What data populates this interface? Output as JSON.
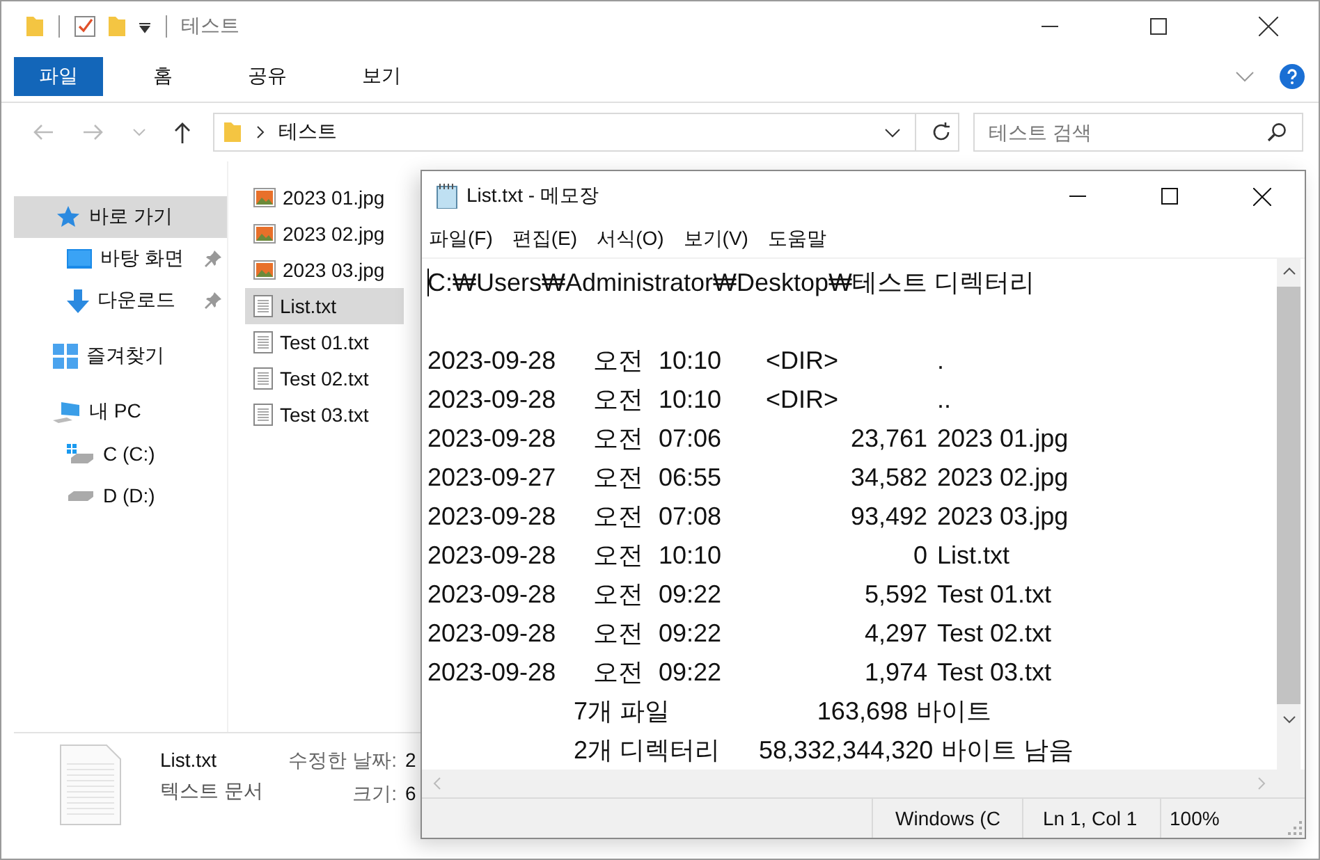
{
  "explorer": {
    "title": "테스트",
    "ribbon_tabs": [
      {
        "label": "파일",
        "selected": true
      },
      {
        "label": "홈",
        "selected": false
      },
      {
        "label": "공유",
        "selected": false
      },
      {
        "label": "보기",
        "selected": false
      }
    ],
    "address": {
      "path": "테스트"
    },
    "search": {
      "placeholder": "테스트 검색"
    },
    "nav": [
      {
        "label": "바로 가기",
        "kind": "star",
        "selected": true,
        "children": [
          {
            "label": "바탕 화면",
            "kind": "desktop",
            "pinned": true,
            "selected": false
          },
          {
            "label": "다운로드",
            "kind": "download",
            "pinned": true,
            "selected": false
          }
        ]
      },
      {
        "label": "즐겨찾기",
        "kind": "tiles",
        "selected": false
      },
      {
        "label": "내 PC",
        "kind": "pc",
        "selected": false,
        "children": [
          {
            "label": "C (C:)",
            "kind": "system-drive",
            "selected": false
          },
          {
            "label": "D (D:)",
            "kind": "drive",
            "selected": false
          }
        ]
      }
    ],
    "files": [
      {
        "name": "2023 01.jpg",
        "kind": "image",
        "selected": false
      },
      {
        "name": "2023 02.jpg",
        "kind": "image",
        "selected": false
      },
      {
        "name": "2023 03.jpg",
        "kind": "image",
        "selected": false
      },
      {
        "name": "List.txt",
        "kind": "text",
        "selected": true
      },
      {
        "name": "Test 01.txt",
        "kind": "text",
        "selected": false
      },
      {
        "name": "Test 02.txt",
        "kind": "text",
        "selected": false
      },
      {
        "name": "Test 03.txt",
        "kind": "text",
        "selected": false
      }
    ],
    "details": {
      "name": "List.txt",
      "type": "텍스트 문서",
      "fields": [
        {
          "label": "수정한 날짜:",
          "value": "2"
        },
        {
          "label": "크기:",
          "value": "6"
        }
      ]
    }
  },
  "notepad": {
    "title": "List.txt - 메모장",
    "menu": [
      "파일(F)",
      "편집(E)",
      "서식(O)",
      "보기(V)",
      "도움말"
    ],
    "path_line": "C:₩Users₩Administrator₩Desktop₩테스트 디렉터리",
    "entries": [
      {
        "date": "2023-09-28",
        "period": "오전",
        "time": "10:10",
        "dir": "<DIR>",
        "name": "."
      },
      {
        "date": "2023-09-28",
        "period": "오전",
        "time": "10:10",
        "dir": "<DIR>",
        "name": ".."
      },
      {
        "date": "2023-09-28",
        "period": "오전",
        "time": "07:06",
        "size": "23,761",
        "name": "2023 01.jpg"
      },
      {
        "date": "2023-09-27",
        "period": "오전",
        "time": "06:55",
        "size": "34,582",
        "name": "2023 02.jpg"
      },
      {
        "date": "2023-09-28",
        "period": "오전",
        "time": "07:08",
        "size": "93,492",
        "name": "2023 03.jpg"
      },
      {
        "date": "2023-09-28",
        "period": "오전",
        "time": "10:10",
        "size": "0",
        "name": "List.txt"
      },
      {
        "date": "2023-09-28",
        "period": "오전",
        "time": "09:22",
        "size": "5,592",
        "name": "Test 01.txt"
      },
      {
        "date": "2023-09-28",
        "period": "오전",
        "time": "09:22",
        "size": "4,297",
        "name": "Test 02.txt"
      },
      {
        "date": "2023-09-28",
        "period": "오전",
        "time": "09:22",
        "size": "1,974",
        "name": "Test 03.txt"
      }
    ],
    "summary": [
      {
        "label": "7개 파일",
        "size": "163,698",
        "unit": "바이트"
      },
      {
        "label": "2개 디렉터리",
        "size": "58,332,344,320",
        "unit": "바이트 남음"
      }
    ],
    "status": [
      "Windows (C",
      "Ln 1, Col 1",
      "100%"
    ]
  }
}
